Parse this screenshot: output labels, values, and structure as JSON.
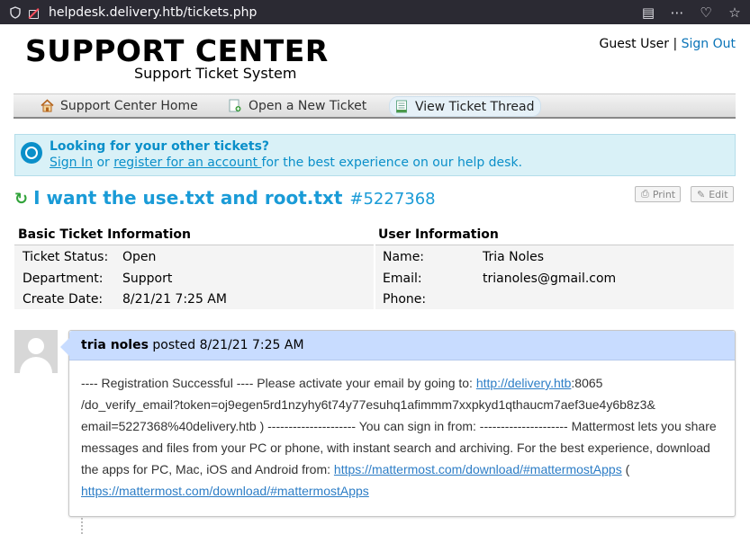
{
  "browser": {
    "url": "helpdesk.delivery.htb/tickets.php"
  },
  "header": {
    "logo_title": "SUPPORT CENTER",
    "logo_subtitle": "Support Ticket System",
    "user_label": "Guest User",
    "separator": "|",
    "sign_out": "Sign Out"
  },
  "nav": {
    "items": [
      {
        "label": "Support Center Home",
        "icon": "home-icon"
      },
      {
        "label": "Open a New Ticket",
        "icon": "new-ticket-icon"
      },
      {
        "label": "View Ticket Thread",
        "icon": "ticket-thread-icon",
        "active": true
      }
    ]
  },
  "notice": {
    "heading": "Looking for your other tickets?",
    "sign_in": "Sign In",
    "or": " or ",
    "register": "register for an account ",
    "rest": "for the best experience on our help desk."
  },
  "ticket": {
    "subject": "I want the use.txt and root.txt",
    "number": "#5227368",
    "print_label": "Print",
    "edit_label": "Edit"
  },
  "basic_info": {
    "heading": "Basic Ticket Information",
    "rows": [
      {
        "label": "Ticket Status:",
        "value": "Open"
      },
      {
        "label": "Department:",
        "value": "Support"
      },
      {
        "label": "Create Date:",
        "value": "8/21/21 7:25 AM"
      }
    ]
  },
  "user_info": {
    "heading": "User Information",
    "rows": [
      {
        "label": "Name:",
        "value": "Tria Noles"
      },
      {
        "label": "Email:",
        "value": "trianoles@gmail.com"
      },
      {
        "label": "Phone:",
        "value": ""
      }
    ]
  },
  "thread": {
    "author": "tria noles",
    "posted": " posted 8/21/21 7:25 AM",
    "line1_text": "---- Registration Successful ---- Please activate your email by going to: ",
    "line1_link": "http://delivery.htb",
    "line1_rest": ":8065",
    "line2": "/do_verify_email?token=oj9egen5rd1nzyhy6t74y77esuhq1afimmm7xxpkyd1qthaucm7aef3ue4y6b8z3&",
    "line3": "email=5227368%40delivery.htb ) --------------------- You can sign in from: --------------------- Mattermost lets you share",
    "line4": "messages and files from your PC or phone, with instant search and archiving. For the best experience, download",
    "line5_text": "the apps for PC, Mac, iOS and Android from: ",
    "line5_link": "https://mattermost.com/download/#mattermostApps",
    "line5_rest": " (",
    "line6_link": "https://mattermost.com/download/#mattermostApps"
  }
}
